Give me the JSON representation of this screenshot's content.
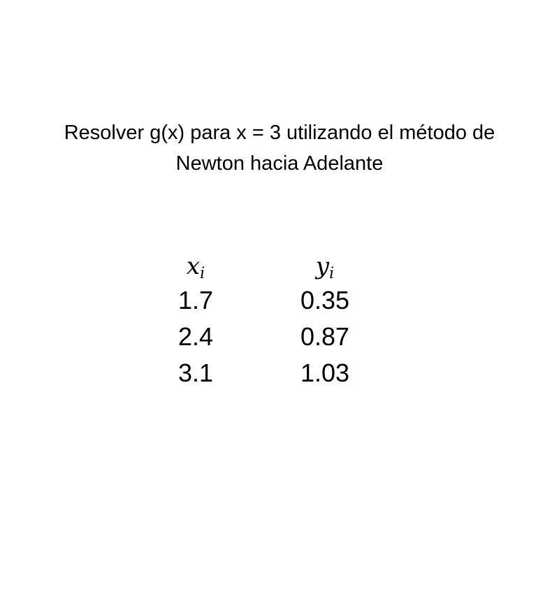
{
  "problem": {
    "line1": "Resolver g(x) para x = 3 utilizando  el método de",
    "line2": "Newton hacia Adelante"
  },
  "table": {
    "x_header": {
      "symbol": "x",
      "subscript": "i"
    },
    "y_header": {
      "symbol": "y",
      "subscript": "i"
    },
    "x_values": [
      "1.7",
      "2.4",
      "3.1"
    ],
    "y_values": [
      "0.35",
      "0.87",
      "1.03"
    ]
  }
}
